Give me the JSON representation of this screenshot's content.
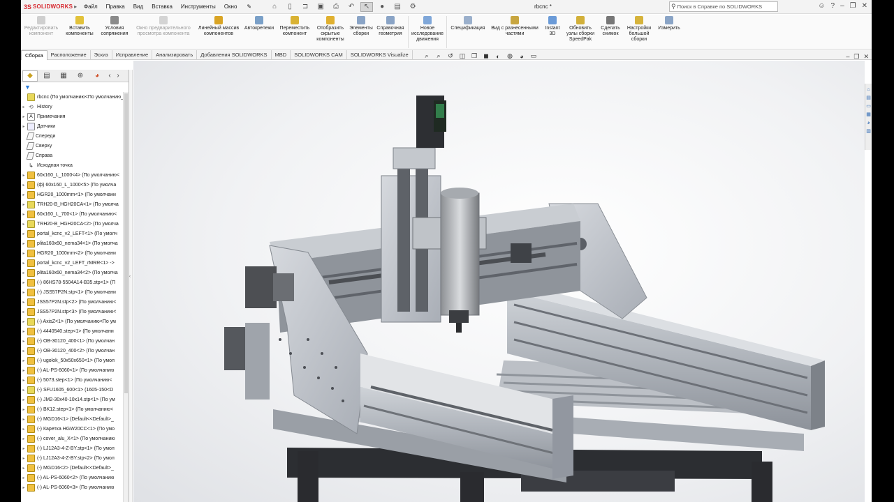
{
  "app": {
    "brand": "SOLIDWORKS",
    "document_title": "rbcnc *",
    "menu": [
      "Файл",
      "Правка",
      "Вид",
      "Вставка",
      "Инструменты",
      "Окно"
    ],
    "help_search_placeholder": "Поиск в Справке по SOLIDWORKS"
  },
  "ribbon": {
    "buttons": [
      {
        "label": "Редактировать компонент",
        "enabled": false,
        "icon": "edit-component-icon",
        "color": "#c9c9c9"
      },
      {
        "label": "Вставить компоненты",
        "enabled": true,
        "icon": "insert-components-icon",
        "color": "#e2c23a"
      },
      {
        "label": "Условия сопряжения",
        "enabled": true,
        "icon": "mate-icon",
        "color": "#8a8a8a"
      },
      {
        "label": "Окно предварительного просмотра компонента",
        "enabled": false,
        "icon": "component-preview-icon",
        "color": "#cccccc"
      },
      {
        "label": "Линейный массив компонентов",
        "enabled": true,
        "icon": "linear-pattern-icon",
        "color": "#d9a425"
      },
      {
        "label": "Автокрепежи",
        "enabled": true,
        "icon": "smart-fasteners-icon",
        "color": "#7aa0c8"
      },
      {
        "label": "Переместить компонент",
        "enabled": true,
        "icon": "move-component-icon",
        "color": "#d9b233"
      },
      {
        "label": "Отобразить скрытые компоненты",
        "enabled": true,
        "icon": "show-hidden-icon",
        "color": "#e0b030"
      },
      {
        "label": "Элементы сборки",
        "enabled": true,
        "icon": "assembly-features-icon",
        "color": "#8aa4c6"
      },
      {
        "label": "Справочная геометрия",
        "enabled": true,
        "icon": "reference-geometry-icon",
        "color": "#8aa4c6"
      },
      {
        "label": "Новое исследование движения",
        "enabled": true,
        "icon": "motion-study-icon",
        "color": "#7fa7d9"
      },
      {
        "label": "Спецификация",
        "enabled": true,
        "icon": "bom-icon",
        "color": "#9bb0cc"
      },
      {
        "label": "Вид с разнесенными частями",
        "enabled": true,
        "icon": "exploded-view-icon",
        "color": "#c8a640"
      },
      {
        "label": "Instant 3D",
        "enabled": true,
        "icon": "instant3d-icon",
        "color": "#6b9bd8"
      },
      {
        "label": "Обновить узлы сборки SpeedPak",
        "enabled": true,
        "icon": "speedpak-icon",
        "color": "#d2b03a"
      },
      {
        "label": "Сделать снимок",
        "enabled": true,
        "icon": "snapshot-icon",
        "color": "#777777"
      },
      {
        "label": "Настройки большой сборки",
        "enabled": true,
        "icon": "large-assembly-icon",
        "color": "#d6b33b"
      },
      {
        "label": "Измерить",
        "enabled": true,
        "icon": "measure-icon",
        "color": "#8aa4c6"
      }
    ]
  },
  "tabs": [
    "Сборка",
    "Расположение",
    "Эскиз",
    "Исправление",
    "Анализировать",
    "Добавления SOLIDWORKS",
    "MBD",
    "SOLIDWORKS CAM",
    "SOLIDWORKS Visualize"
  ],
  "active_tab": "Сборка",
  "tree": {
    "root": "rbcnc  (По умолчанию<По умолчанию_С",
    "items": [
      {
        "label": "History",
        "icon": "history"
      },
      {
        "label": "Примечания",
        "icon": "note"
      },
      {
        "label": "Датчики",
        "icon": "sensor"
      },
      {
        "label": "Спереди",
        "icon": "plane"
      },
      {
        "label": "Сверху",
        "icon": "plane"
      },
      {
        "label": "Справа",
        "icon": "plane"
      },
      {
        "label": "Исходная точка",
        "icon": "origin"
      },
      {
        "label": "60x160_L_1000<4> (По умолчанию<",
        "icon": "part"
      },
      {
        "label": "(ф) 60x160_L_1000<5> (По умолча",
        "icon": "part"
      },
      {
        "label": "HGR20_1000mm<1> (По умолчани",
        "icon": "part"
      },
      {
        "label": "TRH20-B_HGH20CA<1> (По умолча",
        "icon": "asm"
      },
      {
        "label": "60x160_L_700<1> (По умолчанию<",
        "icon": "part"
      },
      {
        "label": "TRH20-B_HGH20CA<2> (По умолча",
        "icon": "asm"
      },
      {
        "label": "portal_kcnc_v2_LEFT<1> (По умолч",
        "icon": "part"
      },
      {
        "label": "plita160x60_nema34<1> (По умолча",
        "icon": "part"
      },
      {
        "label": "HGR20_1000mm<2> (По умолчани",
        "icon": "part"
      },
      {
        "label": "portal_kcnc_v2_LEFT_rMRR<1> ->",
        "icon": "part"
      },
      {
        "label": "plita160x60_nema34<2> (По умолча",
        "icon": "part"
      },
      {
        "label": "(-) 86HS78-5504A14-B35.stp<1> (П",
        "icon": "part"
      },
      {
        "label": "(-) JSS57P2N.stp<1> (По умолчани",
        "icon": "part"
      },
      {
        "label": "JSS57P2N.stp<2> (По умолчанию<",
        "icon": "part"
      },
      {
        "label": "JSS57P2N.stp<3> (По умолчанию<",
        "icon": "part"
      },
      {
        "label": "(-) AxisZ<1> (По умолчанию<По ум",
        "icon": "asm"
      },
      {
        "label": "(-) 4440540.step<1> (По умолчани",
        "icon": "part"
      },
      {
        "label": "(-) OB-30120_400<1> (По умолчан",
        "icon": "part"
      },
      {
        "label": "(-) OB-30120_400<2> (По умолчан",
        "icon": "part"
      },
      {
        "label": "(-) ugolok_50x50x650<1> (По умол",
        "icon": "part"
      },
      {
        "label": "(-) AL-PS-6060<1> (По умолчанию",
        "icon": "part"
      },
      {
        "label": "(-) 5073.step<1> (По умолчанию<",
        "icon": "part"
      },
      {
        "label": "(-) SFU1605_600<1> (1605-150<D",
        "icon": "asm"
      },
      {
        "label": "(-) JM2-30x40-10x14.stp<1> (По ум",
        "icon": "part"
      },
      {
        "label": "(-) BK12.step<1> (По умолчанию<",
        "icon": "part"
      },
      {
        "label": "(-) MGD16<1> (Default<<Default>_",
        "icon": "part"
      },
      {
        "label": "(-) Каретка HGW20CC<1> (По умо",
        "icon": "part"
      },
      {
        "label": "(-) cover_alu_X<1> (По умолчанию",
        "icon": "part"
      },
      {
        "label": "(-) LJ12A3-4-Z-BY.stp<1> (По умол",
        "icon": "part"
      },
      {
        "label": "(-) LJ12A3-4-Z-BY.stp<2> (По умол",
        "icon": "part"
      },
      {
        "label": "(-) MGD16<2> (Default<<Default>_",
        "icon": "part"
      },
      {
        "label": "(-) AL-PS-6060<2> (По умолчанию",
        "icon": "part"
      },
      {
        "label": "(-) AL-PS-6060<3> (По умолчанию",
        "icon": "part"
      }
    ]
  },
  "colors": {
    "accent": "#d7282f",
    "frame_dark": "#3a3c40",
    "aluminum": "#b9bec6",
    "plate": "#c8ccd2"
  }
}
